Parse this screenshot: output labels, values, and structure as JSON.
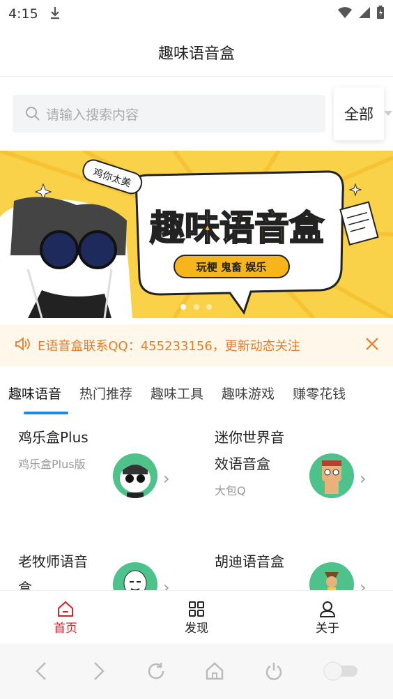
{
  "status_bar": {
    "time": "4:15"
  },
  "app_title": "趣味语音盒",
  "search": {
    "placeholder": "请输入搜索内容",
    "filter_label": "全部"
  },
  "banner": {
    "title": "趣味语音盒",
    "bubble_text": "鸡你太美",
    "tags": "玩梗 鬼畜 娱乐",
    "dot_count": 3,
    "active_dot": 1
  },
  "notice": {
    "text": "E语音盒联系QQ：455233156，更新动态关注"
  },
  "tabs": [
    {
      "label": "趣味语音"
    },
    {
      "label": "热门推荐"
    },
    {
      "label": "趣味工具"
    },
    {
      "label": "趣味游戏"
    },
    {
      "label": "赚零花钱"
    }
  ],
  "items": [
    {
      "name": "鸡乐盒Plus",
      "desc": "鸡乐盒Plus版"
    },
    {
      "name": "迷你世界音效语音盒",
      "desc": "大包Q"
    },
    {
      "name": "老牧师语音盒",
      "desc": ""
    },
    {
      "name": "胡迪语音盒",
      "desc": ""
    }
  ],
  "bottom_nav": [
    {
      "label": "首页",
      "icon": "home-icon",
      "active": true
    },
    {
      "label": "发现",
      "icon": "grid-icon",
      "active": false
    },
    {
      "label": "关于",
      "icon": "user-icon",
      "active": false
    }
  ],
  "colors": {
    "accent": "#d81e26",
    "tab_indicator": "#1e88e5",
    "notice_text": "#e87b27",
    "banner_bg": "#fad24a"
  }
}
